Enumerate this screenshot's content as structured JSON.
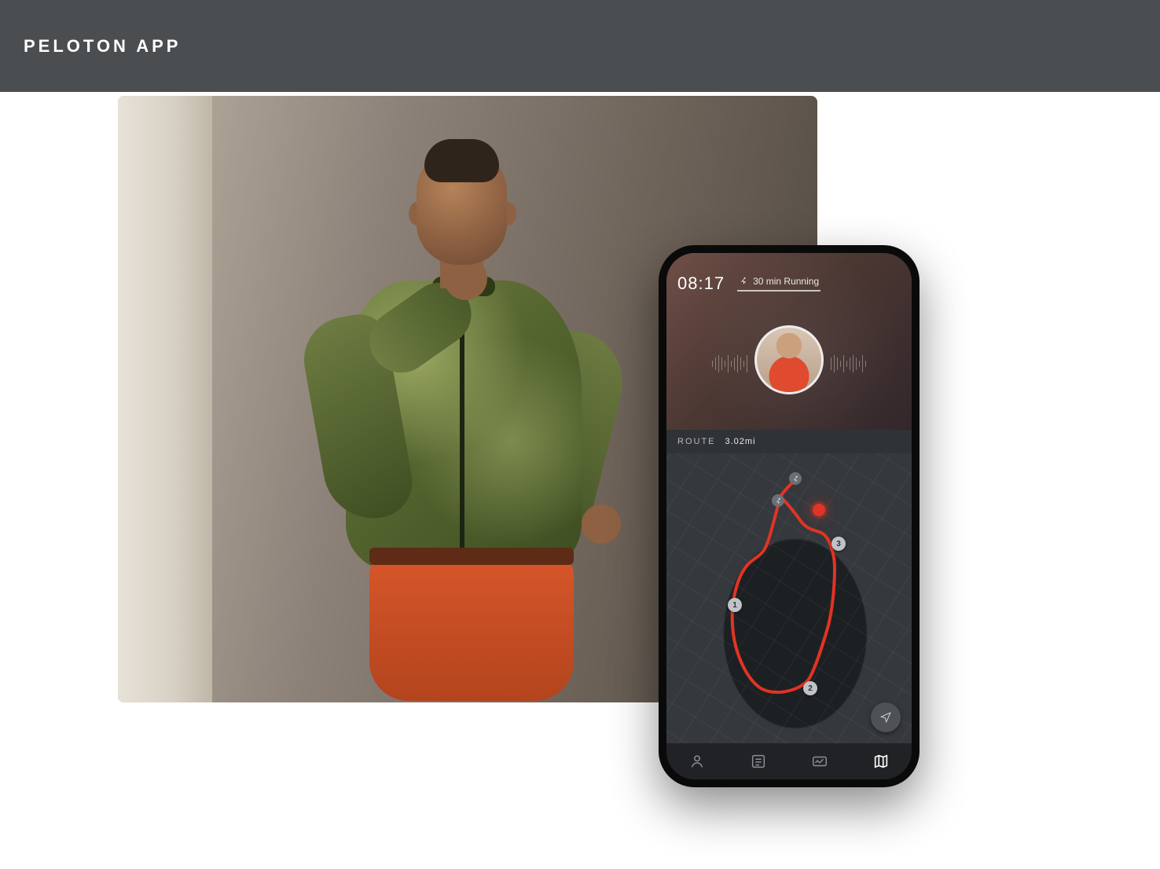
{
  "banner": {
    "title": "PELOTON APP"
  },
  "workout": {
    "elapsed": "08:17",
    "label": "30 min Running"
  },
  "route": {
    "label": "ROUTE",
    "distance": "3.02mi",
    "waypoints": [
      "1",
      "2",
      "3"
    ],
    "current_marker": "live"
  },
  "icons": {
    "runner": "runner-icon",
    "locate": "locate-icon",
    "tab_profile": "profile-icon",
    "tab_feed": "feed-icon",
    "tab_stats": "stats-icon",
    "tab_map": "map-icon"
  },
  "tabs": {
    "active_index": 3
  },
  "colors": {
    "banner_bg": "#4b4e51",
    "accent_red": "#e03424",
    "phone_bg": "#2c2e31",
    "map_bg": "#35383c"
  }
}
